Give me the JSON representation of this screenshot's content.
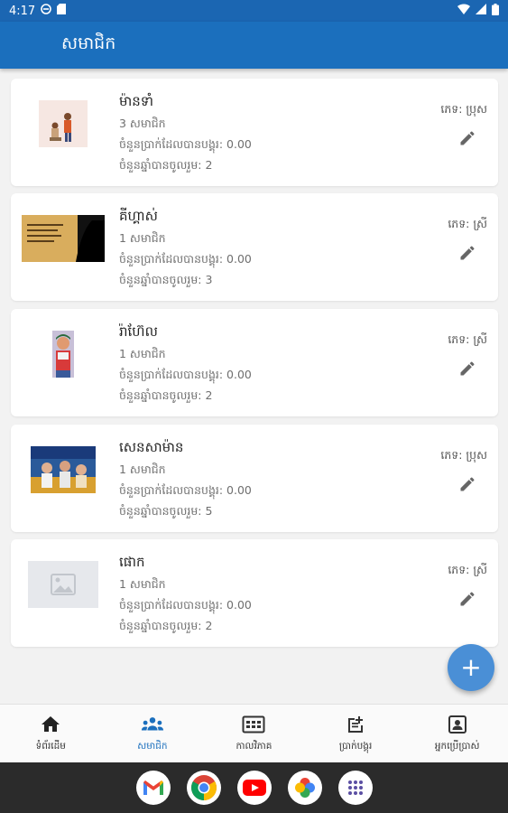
{
  "status_bar": {
    "time": "4:17"
  },
  "app_bar": {
    "title": "សមាជិក"
  },
  "members": [
    {
      "name": "ម៉ានទាំ",
      "count": "3 សមាជិក",
      "money": "ចំនួនប្រាក់ដែលបានបង្គុរ: 0.00",
      "tenure": "ចំនួនឆ្នាំបានចូលរួម: 2",
      "gender": "ភេទ: ប្រុស"
    },
    {
      "name": "គីហ្គាស់",
      "count": "1 សមាជិក",
      "money": "ចំនួនប្រាក់ដែលបានបង្គុរ: 0.00",
      "tenure": "ចំនួនឆ្នាំបានចូលរួម: 3",
      "gender": "ភេទ: ស្រី"
    },
    {
      "name": "រ៉ាហ៊ែល",
      "count": "1 សមាជិក",
      "money": "ចំនួនប្រាក់ដែលបានបង្គុរ: 0.00",
      "tenure": "ចំនួនឆ្នាំបានចូលរួម: 2",
      "gender": "ភេទ: ស្រី"
    },
    {
      "name": "សេនសាម៉ាន",
      "count": "1 សមាជិក",
      "money": "ចំនួនប្រាក់ដែលបានបង្គុរ: 0.00",
      "tenure": "ចំនួនឆ្នាំបានចូលរួម: 5",
      "gender": "ភេទ: ប្រុស"
    },
    {
      "name": "ផោក",
      "count": "1 សមាជិក",
      "money": "ចំនួនប្រាក់ដែលបានបង្គុរ: 0.00",
      "tenure": "ចំនួនឆ្នាំបានចូលរួម: 2",
      "gender": "ភេទ: ស្រី"
    }
  ],
  "bottom_nav": [
    {
      "label": "ទំព័រដើម",
      "icon": "home-icon"
    },
    {
      "label": "សមាជិក",
      "icon": "people-icon"
    },
    {
      "label": "កាលវិភាគ",
      "icon": "schedule-icon"
    },
    {
      "label": "ប្រាក់បង្គុរ",
      "icon": "contribution-icon"
    },
    {
      "label": "អ្នកប្រើប្រាស់",
      "icon": "account-icon"
    }
  ],
  "dock": [
    "gmail-icon",
    "chrome-icon",
    "youtube-icon",
    "photos-icon",
    "app-drawer-icon"
  ],
  "colors": {
    "primary": "#1b6fbd",
    "status_bar": "#1b66b2",
    "fab": "#4a8fd6",
    "background": "#f2f2f2"
  }
}
